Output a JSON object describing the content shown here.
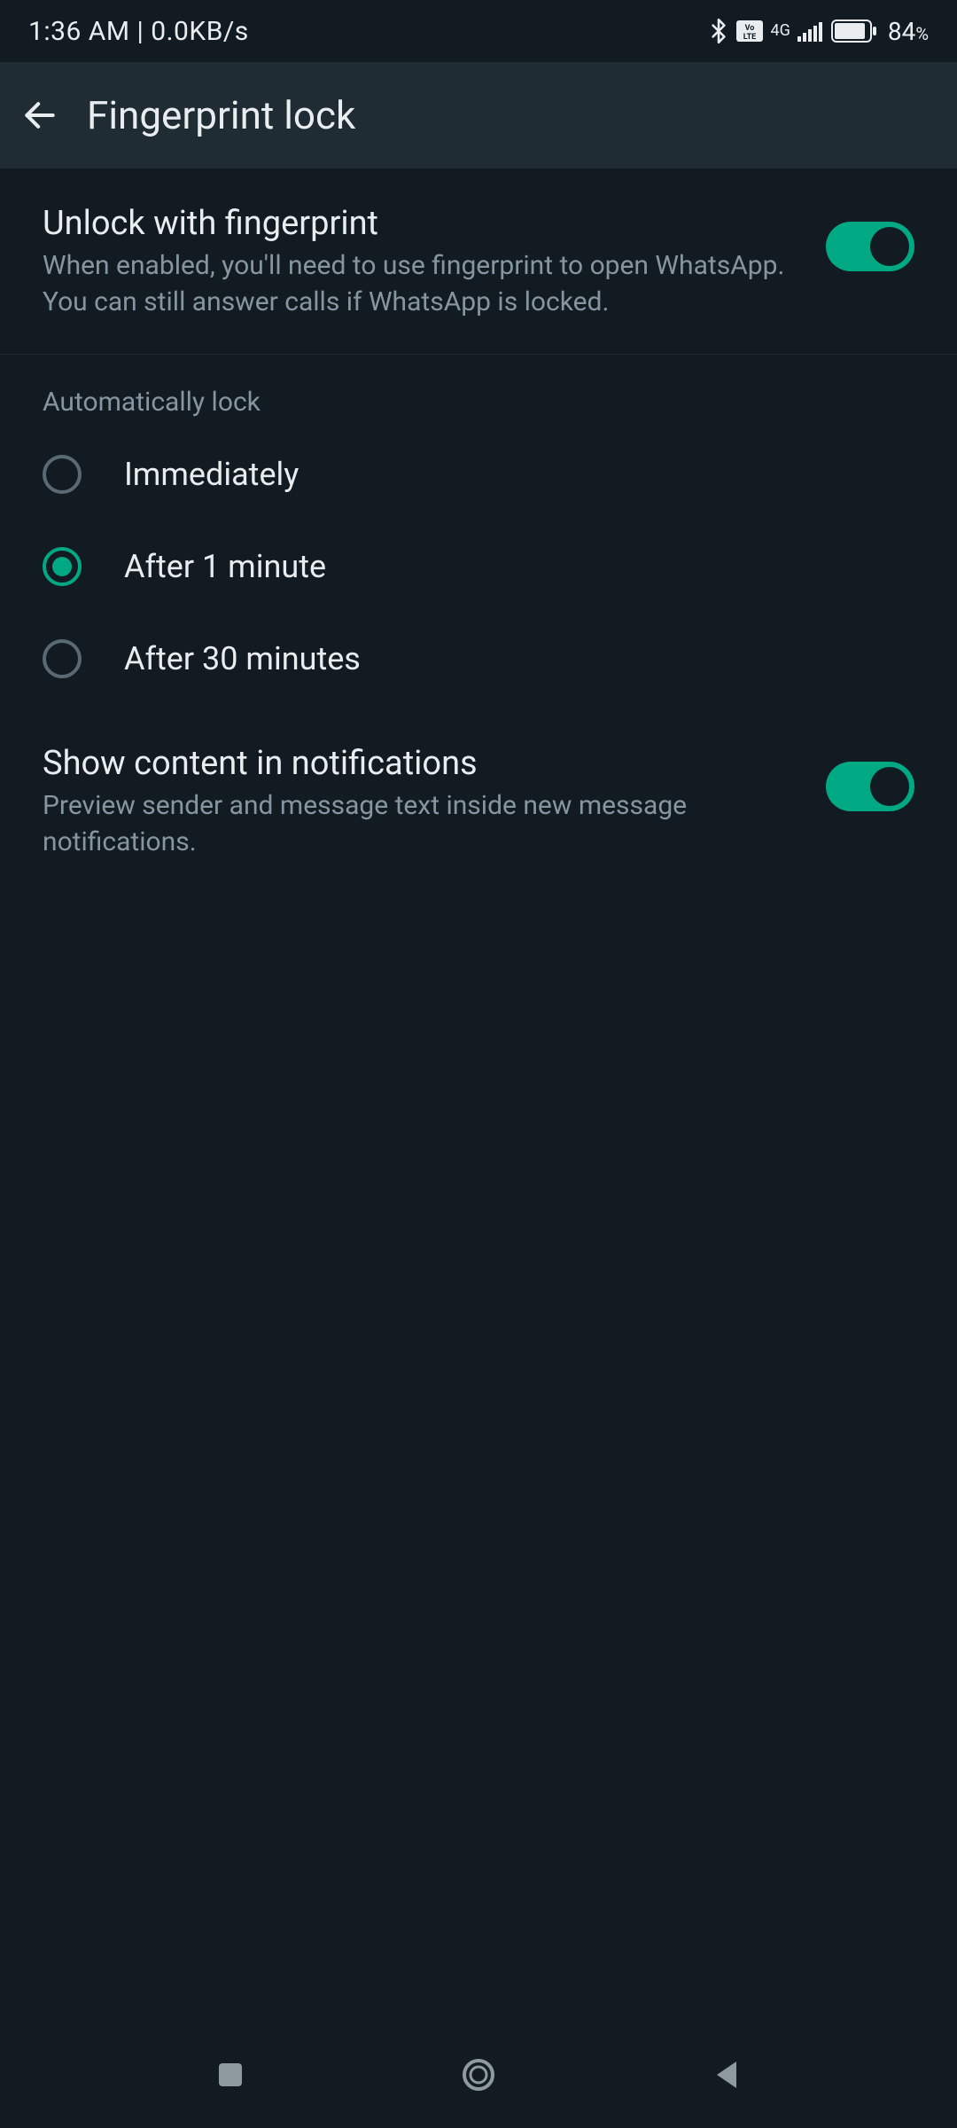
{
  "status_bar": {
    "time": "1:36 AM",
    "net_speed": "0.0KB/s",
    "battery_pct": "84",
    "network_type": "4G"
  },
  "app_bar": {
    "title": "Fingerprint lock"
  },
  "settings": {
    "unlock": {
      "title": "Unlock with fingerprint",
      "desc": "When enabled, you'll need to use fingerprint to open WhatsApp. You can still answer calls if WhatsApp is locked.",
      "enabled": true
    },
    "auto_lock": {
      "header": "Automatically lock",
      "options": [
        {
          "label": "Immediately",
          "selected": false
        },
        {
          "label": "After 1 minute",
          "selected": true
        },
        {
          "label": "After 30 minutes",
          "selected": false
        }
      ]
    },
    "show_content": {
      "title": "Show content in notifications",
      "desc": "Preview sender and message text inside new message notifications.",
      "enabled": true
    }
  }
}
